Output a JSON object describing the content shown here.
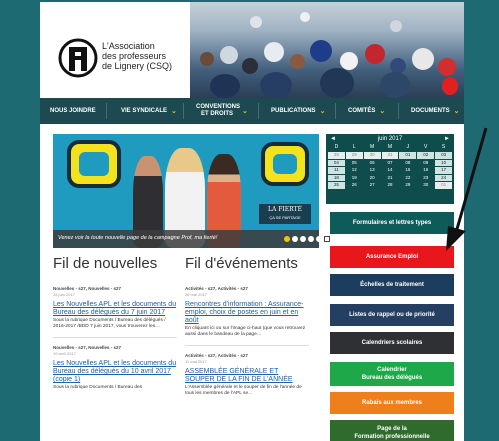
{
  "header": {
    "org_line1": "L'Association",
    "org_line2": "des professeurs",
    "org_line3": "de Lignery (CSQ)"
  },
  "nav": {
    "items": [
      {
        "label": "NOUS JOINDRE",
        "has_menu": false
      },
      {
        "label": "VIE SYNDICALE",
        "has_menu": true
      },
      {
        "label": "CONVENTIONS ET DROITS",
        "has_menu": true
      },
      {
        "label": "PUBLICATIONS",
        "has_menu": true
      },
      {
        "label": "COMITÉS",
        "has_menu": true
      },
      {
        "label": "DOCUMENTS",
        "has_menu": true
      }
    ]
  },
  "banner": {
    "tag_line1": "LA FIERTÉ",
    "tag_line2": "ÇA SE PARTAGE",
    "caption": "Venez voir la toute nouvelle page de la campagne Prof, ma fierté!"
  },
  "news": {
    "title": "Fil de nouvelles",
    "items": [
      {
        "cat": "Nouvelles - s27, Nouvelles - s27",
        "date": "15 juin 2017",
        "headline": "Les Nouvelles APL et les documents du Bureau des délégués du 7 juin 2017",
        "excerpt": "Sous la rubrique Documents / Bureau des délégués / 2016-2017 /BDD 7 juin 2017, vous trouverez les…"
      },
      {
        "cat": "Nouvelles - s27, Nouvelles - s27",
        "date": "19 avril 2017",
        "headline": "Les Nouvelles APL et les documents du Bureau des délégués du 10 avril 2017 (copie 1)",
        "excerpt": "Sous la rubrique Documents / Bureau des"
      }
    ]
  },
  "events": {
    "title": "Fil d'événements",
    "items": [
      {
        "cat": "Activités - s27, Activités - s27",
        "date": "26 mai 2017",
        "headline": "Rencontres d'information : Assurance-emploi, choix de postes en juin et en août",
        "excerpt": "En cliquant ici ou sur l'image ci-haut (que vous retrouvez aussi dans le bandeau de la page…"
      },
      {
        "cat": "Activités - s27, Activités - s27",
        "date": "11 mai 2017",
        "headline": "ASSEMBLÉE GÉNÉRALE ET SOUPER DE LA FIN DE L'ANNÉE",
        "excerpt": "L'Assemblée générale et le souper de fin de l'année de tous les membres de l'APL se…"
      }
    ]
  },
  "calendar": {
    "prev": "◄",
    "next": "►",
    "month": "juin 2017",
    "dows": [
      "D",
      "L",
      "M",
      "M",
      "J",
      "V",
      "S"
    ],
    "days": [
      "28",
      "29",
      "30",
      "31",
      "01",
      "02",
      "03",
      "04",
      "05",
      "06",
      "07",
      "08",
      "09",
      "10",
      "11",
      "12",
      "13",
      "14",
      "15",
      "16",
      "17",
      "18",
      "19",
      "20",
      "21",
      "22",
      "23",
      "24",
      "25",
      "26",
      "27",
      "28",
      "29",
      "30",
      "01"
    ]
  },
  "sidebar": {
    "buttons": [
      {
        "line1": "Formulaires et lettres types",
        "line2": "",
        "color": "#0e5c5a"
      },
      {
        "line1": "Assurance Emploi",
        "line2": "",
        "color": "#e8171b"
      },
      {
        "line1": "Échelles de traitement",
        "line2": "",
        "color": "#1c3d5e"
      },
      {
        "line1": "Listes de rappel ou de priorité",
        "line2": "",
        "color": "#253f63"
      },
      {
        "line1": "Calendriers scolaires",
        "line2": "",
        "color": "#2e3033"
      },
      {
        "line1": "Calendrier",
        "line2": "Bureau des délégués",
        "color": "#1fa84a"
      },
      {
        "line1": "Rabais aux membres",
        "line2": "",
        "color": "#ef7f1a"
      },
      {
        "line1": "Page de la",
        "line2": "Formation professionnelle",
        "color": "#2e6b2d"
      }
    ]
  }
}
